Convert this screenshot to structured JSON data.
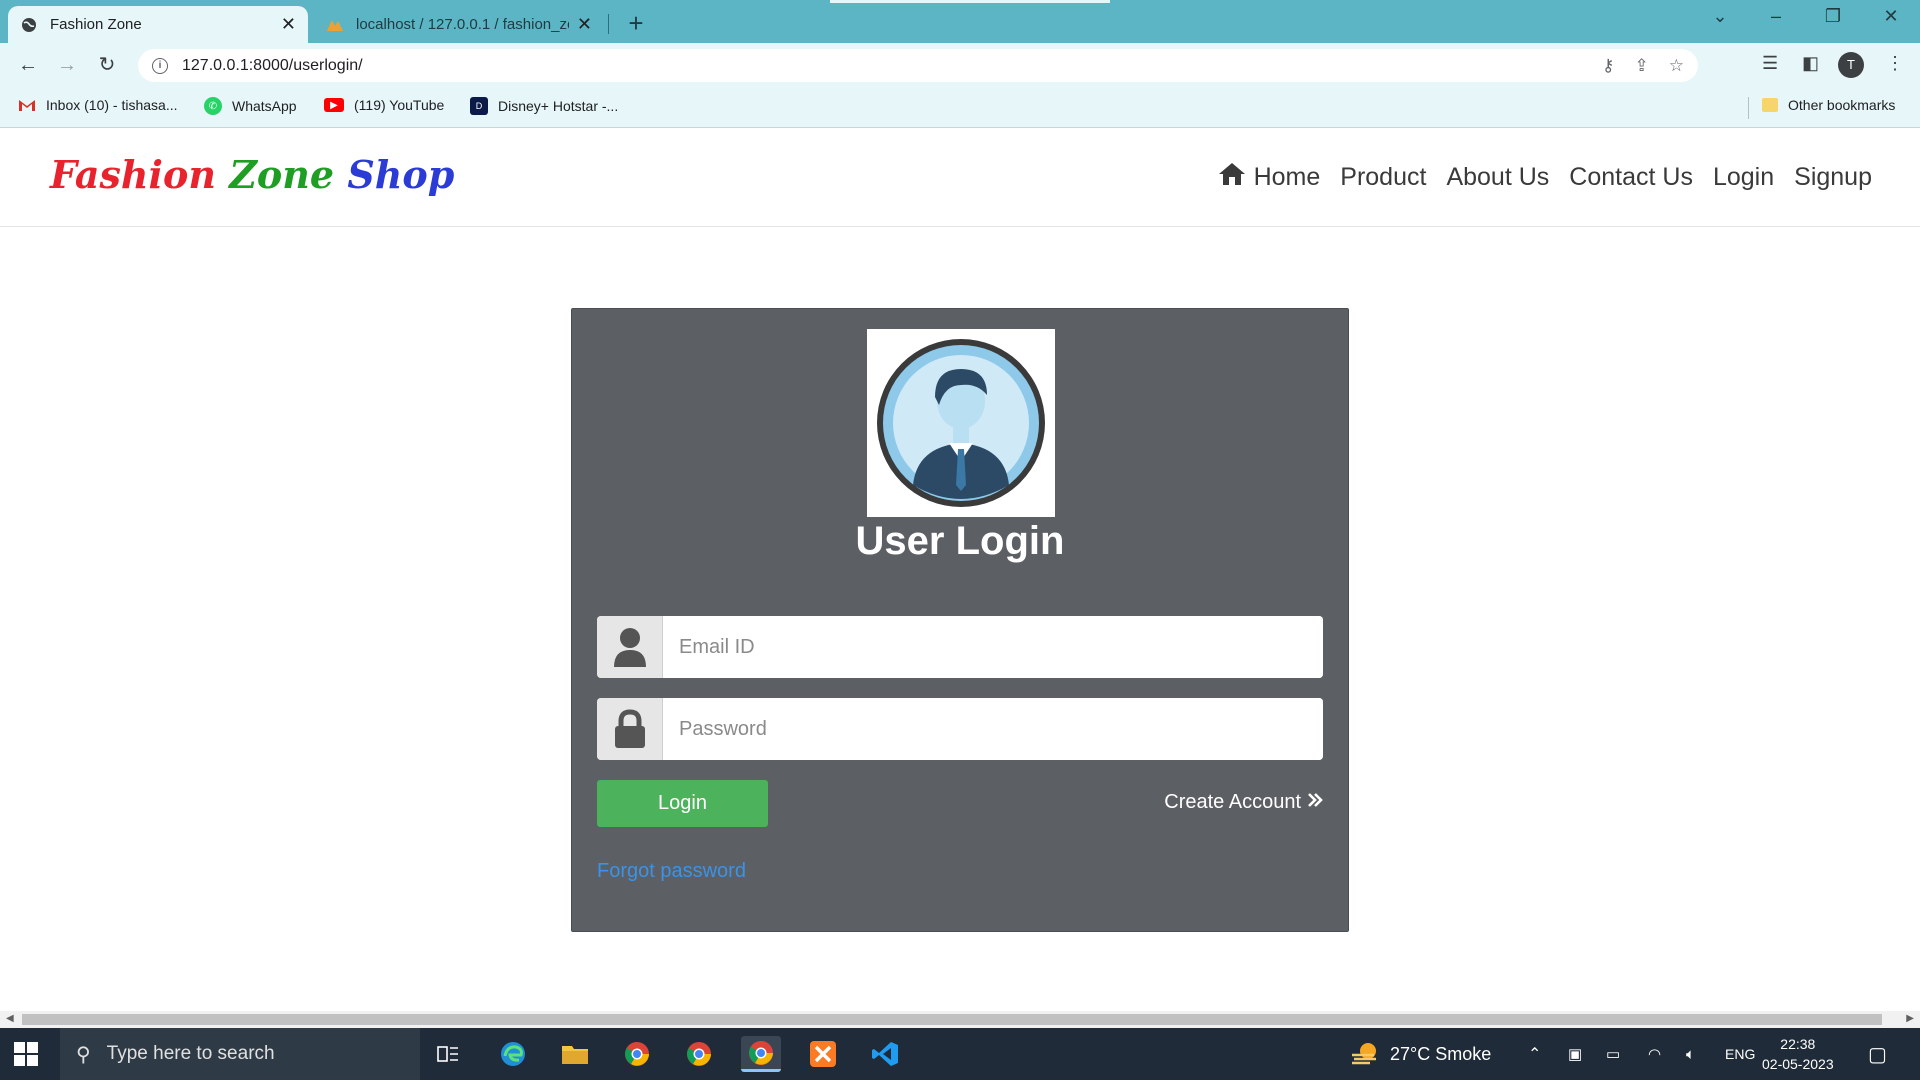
{
  "browser": {
    "tabs": [
      {
        "title": "Fashion Zone",
        "active": true
      },
      {
        "title": "localhost / 127.0.0.1 / fashion_zo",
        "active": false
      }
    ],
    "url": "127.0.0.1:8000/userlogin/",
    "bookmarks": [
      {
        "label": "Inbox (10) - tishasa...",
        "icon": "gmail-icon"
      },
      {
        "label": "WhatsApp",
        "icon": "whatsapp-icon"
      },
      {
        "label": "(119) YouTube",
        "icon": "youtube-icon"
      },
      {
        "label": "Disney+ Hotstar -...",
        "icon": "hotstar-icon"
      }
    ],
    "other_bookmarks": "Other bookmarks",
    "profile_initial": "T"
  },
  "site": {
    "brand": {
      "w1": "Fashion",
      "w2": "Zone",
      "w3": "Shop"
    },
    "menu": {
      "home": "Home",
      "product": "Product",
      "about": "About Us",
      "contact": "Contact Us",
      "login": "Login",
      "signup": "Signup"
    }
  },
  "login": {
    "title": "User Login",
    "email_placeholder": "Email ID",
    "password_placeholder": "Password",
    "login_button": "Login",
    "create_account": "Create Account",
    "forgot_password": "Forgot password"
  },
  "taskbar": {
    "search_placeholder": "Type here to search",
    "weather": "27°C  Smoke",
    "language": "ENG",
    "time": "22:38",
    "date": "02-05-2023"
  },
  "colors": {
    "tab_strip": "#5bb5c4",
    "card_bg": "#5c5f63",
    "login_button": "#4cb25b",
    "forgot_link": "#3a93ea",
    "brand_red": "#e8232e",
    "brand_green": "#1f9e24",
    "brand_blue": "#2a3bd6"
  }
}
